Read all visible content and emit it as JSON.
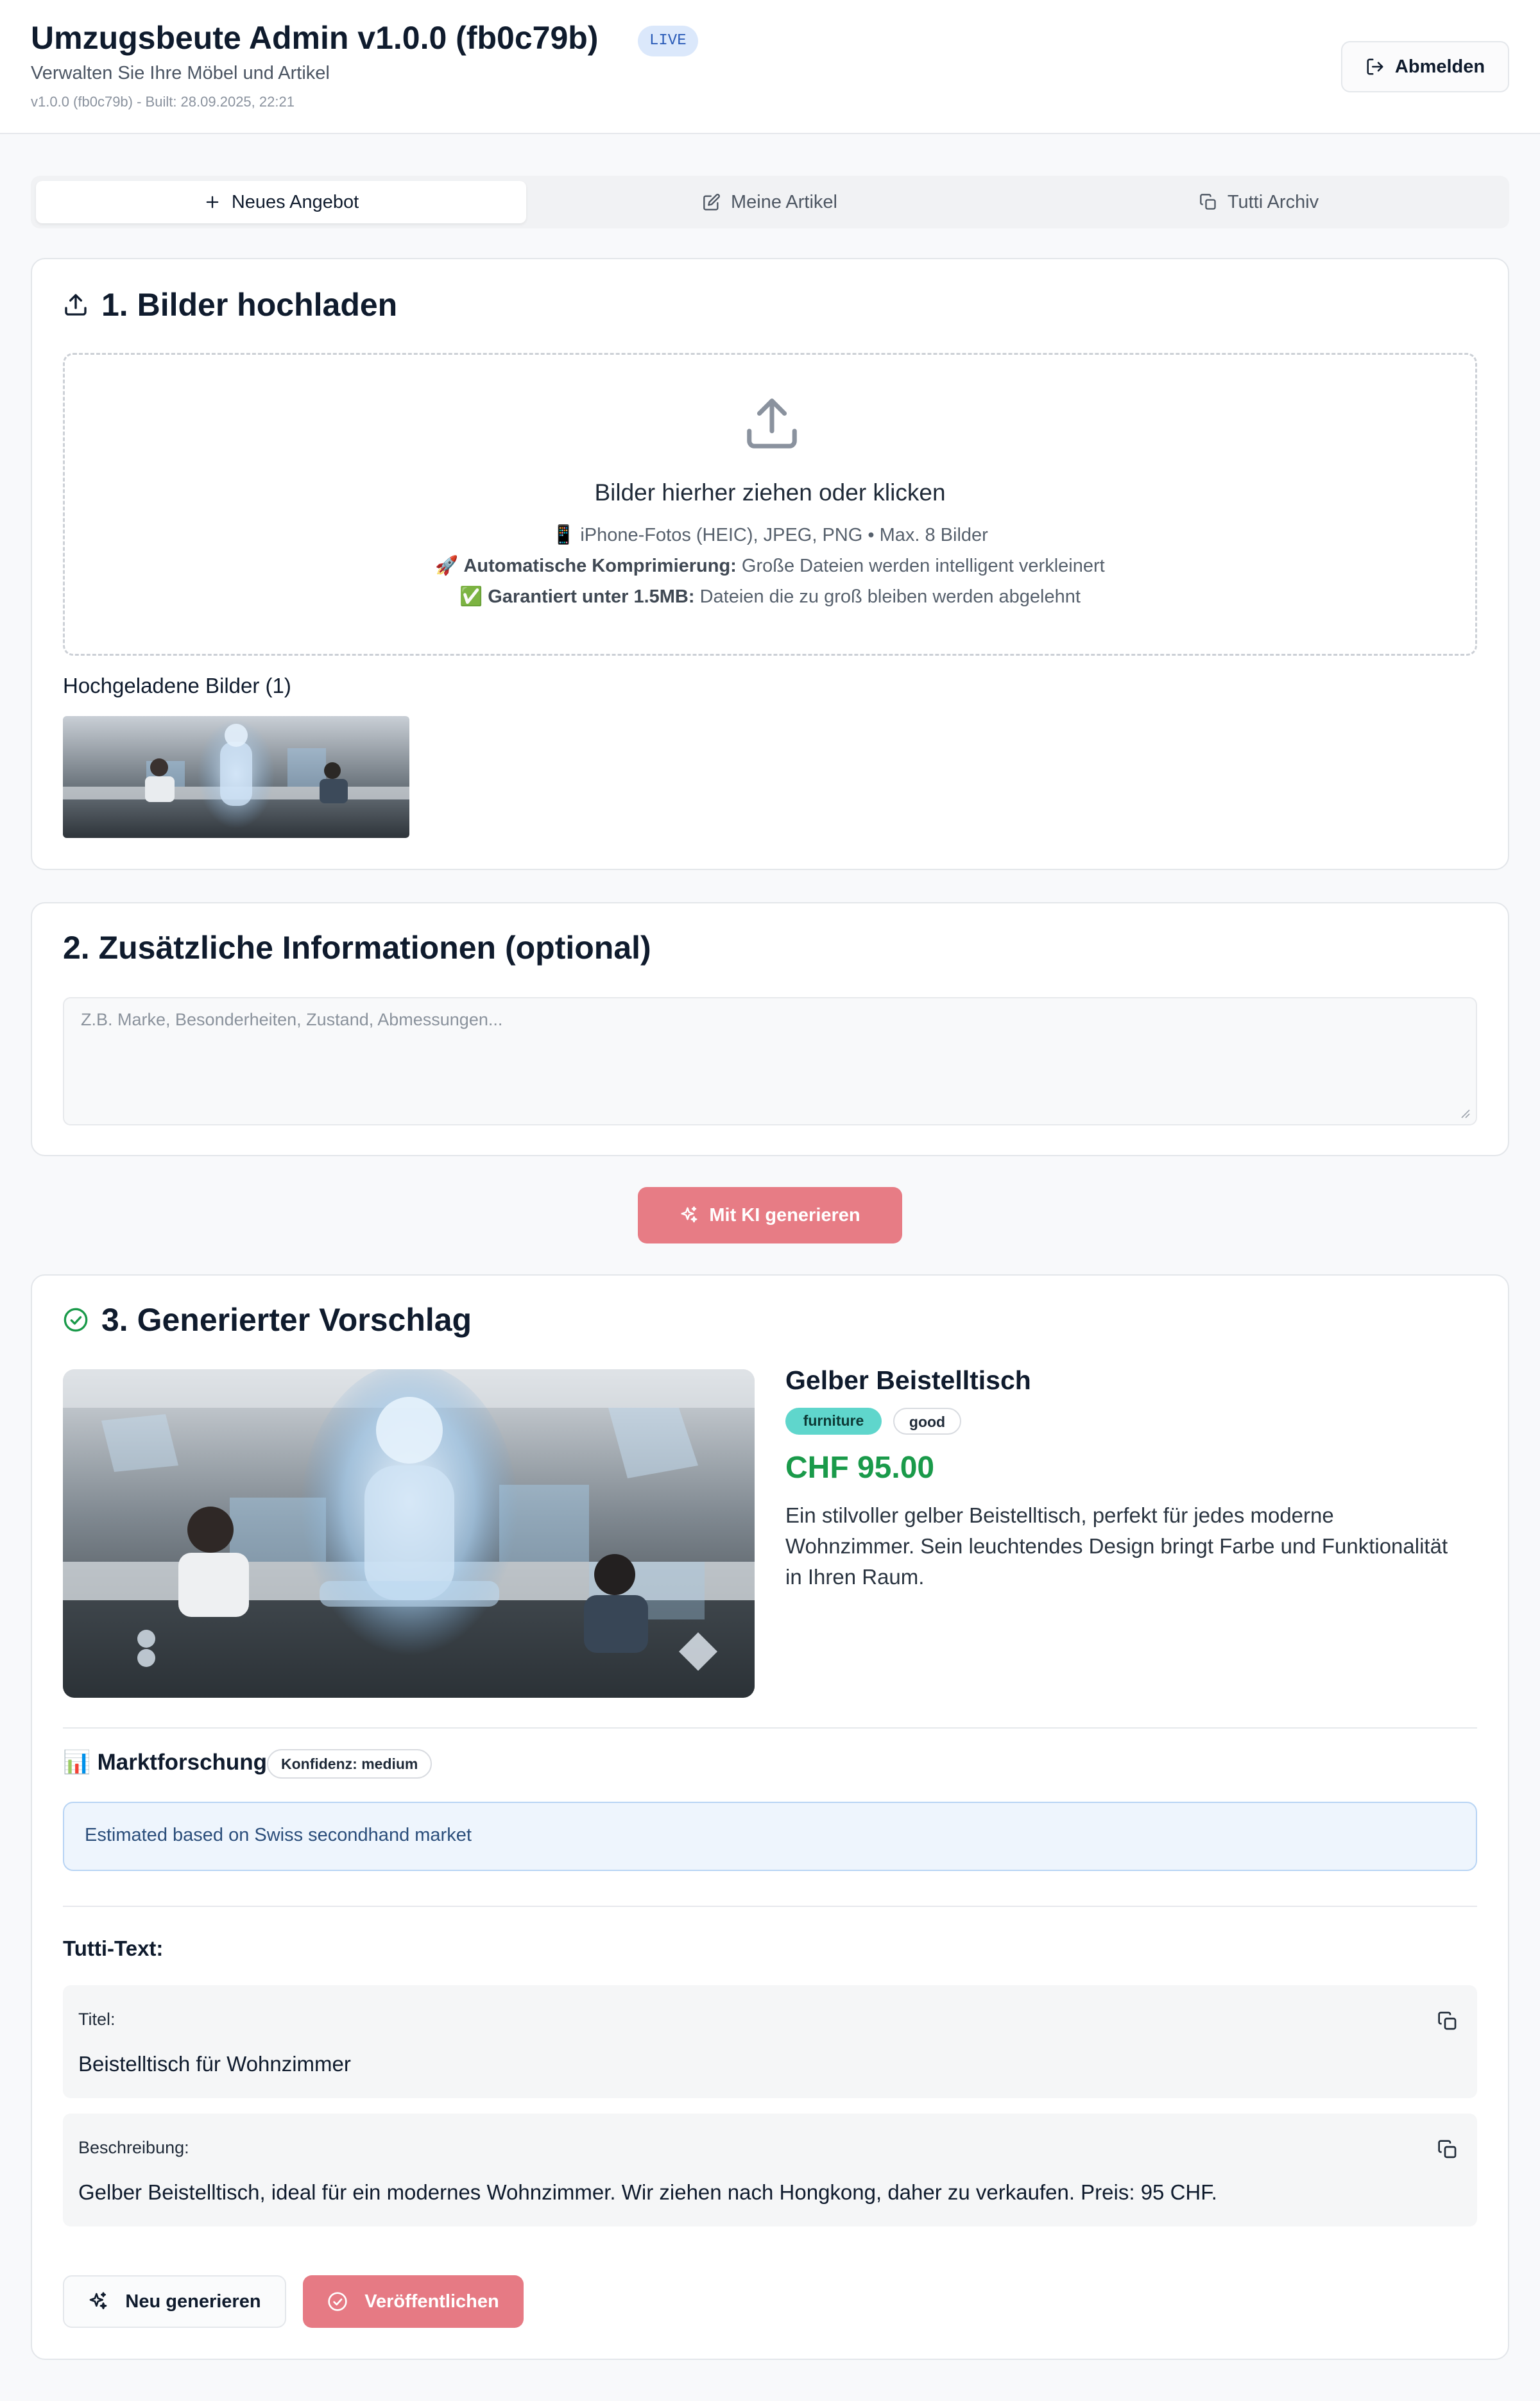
{
  "header": {
    "title": "Umzugsbeute Admin v1.0.0 (fb0c79b)",
    "badge": "LIVE",
    "subtitle": "Verwalten Sie Ihre Möbel und Artikel",
    "build": "v1.0.0 (fb0c79b) - Built: 28.09.2025, 22:21",
    "logout_label": "Abmelden"
  },
  "tabs": [
    {
      "label": "Neues Angebot",
      "icon": "plus-icon",
      "active": true
    },
    {
      "label": "Meine Artikel",
      "icon": "edit-icon",
      "active": false
    },
    {
      "label": "Tutti Archiv",
      "icon": "copy-icon",
      "active": false
    }
  ],
  "upload": {
    "title": "1. Bilder hochladen",
    "dropzone_title": "Bilder hierher ziehen oder klicken",
    "line1": "📱 iPhone-Fotos (HEIC), JPEG, PNG • Max. 8 Bilder",
    "line2_emoji": "🚀",
    "line2_bold": "Automatische Komprimierung:",
    "line2_text": "Große Dateien werden intelligent verkleinert",
    "line3_emoji": "✅",
    "line3_bold": "Garantiert unter 1.5MB:",
    "line3_text": "Dateien die zu groß bleiben werden abgelehnt",
    "uploaded_label": "Hochgeladene Bilder (1)"
  },
  "extra_info": {
    "title": "2. Zusätzliche Informationen (optional)",
    "placeholder": "Z.B. Marke, Besonderheiten, Zustand, Abmessungen..."
  },
  "generate_button": "Mit KI generieren",
  "result": {
    "title": "3. Generierter Vorschlag",
    "item_name": "Gelber Beistelltisch",
    "category": "furniture",
    "condition": "good",
    "price": "CHF 95.00",
    "description": "Ein stilvoller gelber Beistelltisch, perfekt für jedes moderne Wohnzimmer. Sein leuchtendes Design bringt Farbe und Funktionalität in Ihren Raum.",
    "market_title": "Marktforschung",
    "market_emoji": "📊",
    "confidence": "Konfidenz: medium",
    "market_note": "Estimated based on Swiss secondhand market",
    "tutti_label": "Tutti-Text:",
    "title_label": "Titel:",
    "title_value": "Beistelltisch für Wohnzimmer",
    "desc_label": "Beschreibung:",
    "desc_value": "Gelber Beistelltisch, ideal für ein modernes Wohnzimmer. Wir ziehen nach Hongkong, daher zu verkaufen. Preis: 95 CHF.",
    "regen_label": "Neu generieren",
    "publish_label": "Veröffentlichen"
  },
  "colors": {
    "accent_pink": "#e77c85",
    "price_green": "#1a9a4a",
    "category_chip": "#5fd6cc",
    "live_badge": "#dbe8fb",
    "info_box": "#eef5fd"
  }
}
